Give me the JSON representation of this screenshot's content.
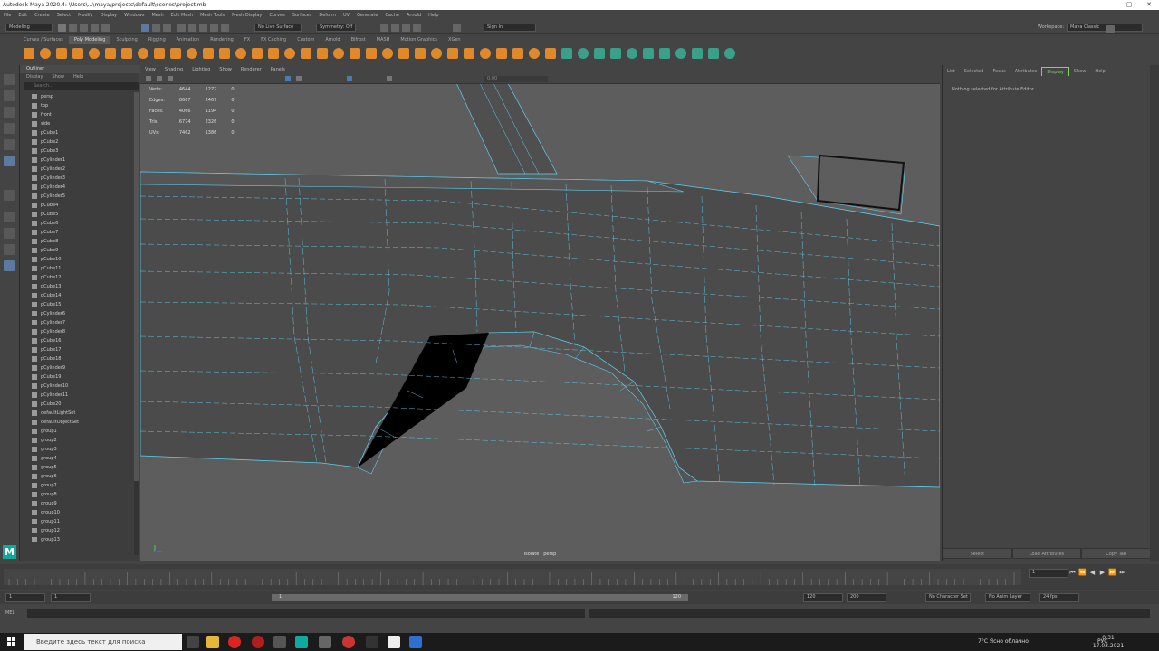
{
  "window": {
    "title": "Autodesk Maya 2020.4: \\Users\\...\\maya\\projects\\default\\scenes\\project.mb",
    "buttons": [
      "–",
      "▢",
      "✕"
    ]
  },
  "menus": [
    "File",
    "Edit",
    "Create",
    "Select",
    "Modify",
    "Display",
    "Windows",
    "Mesh",
    "Edit Mesh",
    "Mesh Tools",
    "Mesh Display",
    "Curves",
    "Surfaces",
    "Deform",
    "UV",
    "Generate",
    "Cache",
    "Arnold",
    "Help"
  ],
  "statusline": {
    "mode": "Modeling",
    "live_surface": "No Live Surface",
    "symmetry": "Symmetry: Off",
    "sign_in": "Sign In",
    "workspace_label": "Workspace:",
    "workspace": "Maya Classic"
  },
  "shelf_tabs": [
    "Curves / Surfaces",
    "Poly Modeling",
    "Sculpting",
    "Rigging",
    "Animation",
    "Rendering",
    "FX",
    "FX Caching",
    "Custom",
    "Arnold",
    "Bifrost",
    "MASH",
    "Motion Graphics",
    "XGen"
  ],
  "active_shelf": "Poly Modeling",
  "outliner": {
    "title": "Outliner",
    "menu": [
      "Display",
      "Show",
      "Help"
    ],
    "search_placeholder": "Search...",
    "items": [
      "persp",
      "top",
      "front",
      "side",
      "pCube1",
      "pCube2",
      "pCube3",
      "pCylinder1",
      "pCylinder2",
      "pCylinder3",
      "pCylinder4",
      "pCylinder5",
      "pCube4",
      "pCube5",
      "pCube6",
      "pCube7",
      "pCube8",
      "pCube9",
      "pCube10",
      "pCube11",
      "pCube12",
      "pCube13",
      "pCube14",
      "pCube15",
      "pCylinder6",
      "pCylinder7",
      "pCylinder8",
      "pCube16",
      "pCube17",
      "pCube18",
      "pCylinder9",
      "pCube19",
      "pCylinder10",
      "pCylinder11",
      "pCube20",
      "defaultLightSet",
      "defaultObjectSet",
      "group1",
      "group2",
      "group3",
      "group4",
      "group5",
      "group6",
      "group7",
      "group8",
      "group9",
      "group10",
      "group11",
      "group12",
      "group13"
    ]
  },
  "viewport": {
    "menu": [
      "View",
      "Shading",
      "Lighting",
      "Show",
      "Renderer",
      "Panels"
    ],
    "hud": [
      {
        "label": "Verts:",
        "a": "4644",
        "b": "1272",
        "c": "0"
      },
      {
        "label": "Edges:",
        "a": "8667",
        "b": "2467",
        "c": "0"
      },
      {
        "label": "Faces:",
        "a": "4066",
        "b": "1194",
        "c": "0"
      },
      {
        "label": "Tris:",
        "a": "6774",
        "b": "2326",
        "c": "0"
      },
      {
        "label": "UVs:",
        "a": "7462",
        "b": "1386",
        "c": "0"
      }
    ],
    "camera": "Isolate : persp",
    "field_value": "0.00"
  },
  "attribute_editor": {
    "tabs": [
      "List",
      "Selected",
      "Focus",
      "Attributes",
      "Display",
      "Show",
      "Help"
    ],
    "active_tab": "Display",
    "message": "Nothing selected for Attribute Editor",
    "buttons": [
      "Select",
      "Load Attributes",
      "Copy Tab"
    ]
  },
  "timeline": {
    "current_frame": "1",
    "start": "1",
    "range_start": "1",
    "range_end": "120",
    "end_range": "120",
    "anim_end": "200",
    "character_set": "No Character Set",
    "anim_layer": "No Anim Layer",
    "fps": "24 fps"
  },
  "command_line": {
    "label": "MEL"
  },
  "taskbar": {
    "search_placeholder": "Введите здесь текст для поиска",
    "weather": "7°C  Ясно облачно",
    "lang": "РУС",
    "time": "0:31",
    "date": "17.03.2021"
  },
  "colors": {
    "wire": "#5fd0f0",
    "accent": "#e0892b",
    "green": "#3aa08a",
    "viewport_bg": "#5d5d5d"
  }
}
